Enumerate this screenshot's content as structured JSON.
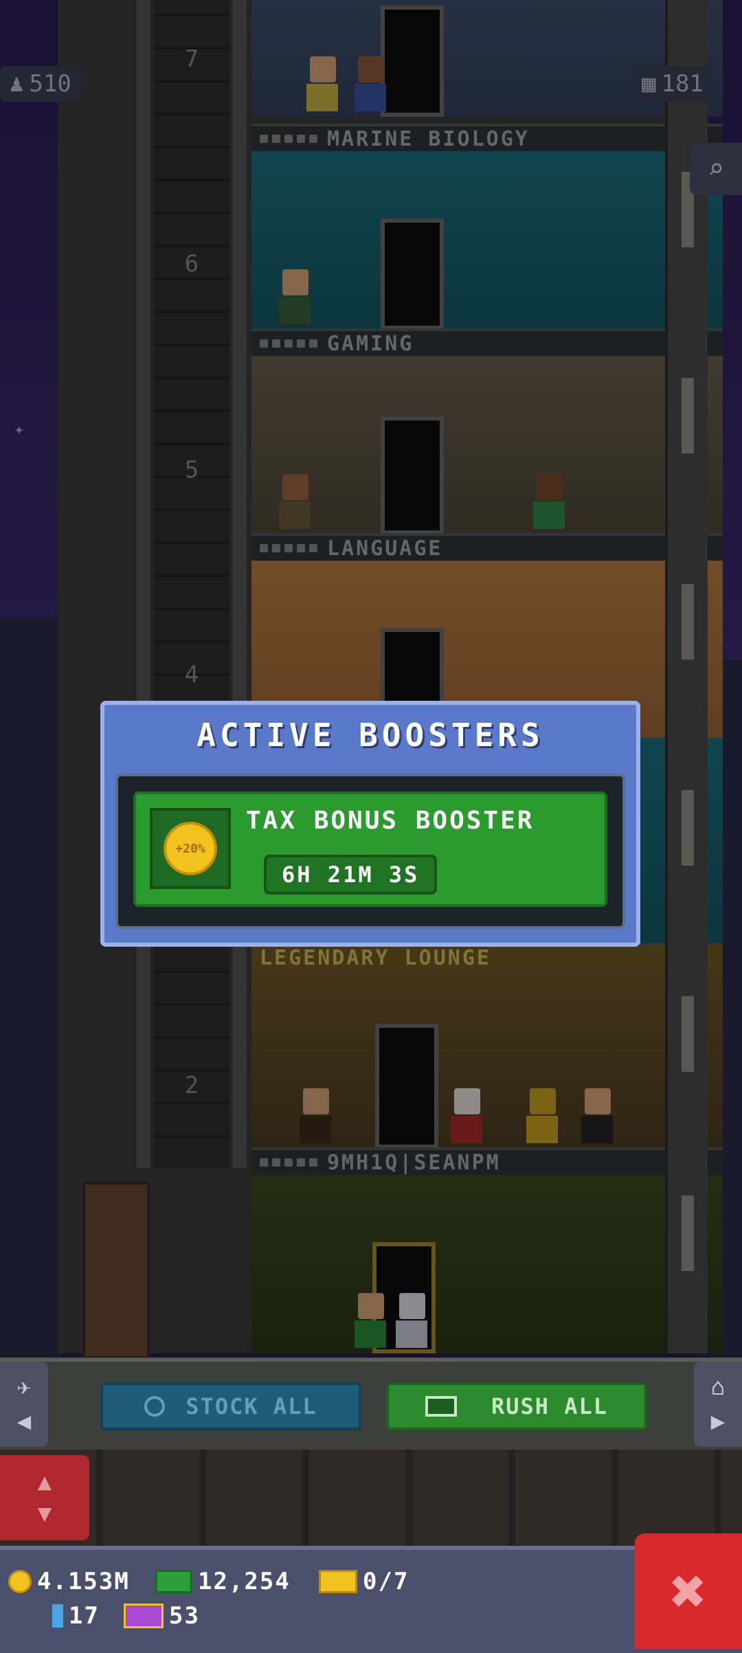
{
  "hud": {
    "population": "510",
    "floors_count": "181"
  },
  "floors": [
    {
      "number": "7",
      "name": ""
    },
    {
      "number": "6",
      "name": "MARINE BIOLOGY"
    },
    {
      "number": "5",
      "name": "GAMING"
    },
    {
      "number": "4",
      "name": "LANGUAGE"
    },
    {
      "number": "2",
      "name": "LEGENDARY LOUNGE"
    },
    {
      "number": "",
      "name": "9MH1Q|SEANPM"
    }
  ],
  "dialog": {
    "title": "ACTIVE BOOSTERS",
    "booster": {
      "name": "TAX BONUS BOOSTER",
      "timer": "6H 21M 3S",
      "badge": "+20%"
    }
  },
  "actions": {
    "stock_all": "STOCK ALL",
    "rush_all": "RUSH ALL"
  },
  "status": {
    "coins": "4.153M",
    "bux": "12,254",
    "vip": "0/7",
    "gems": "17",
    "tickets": "53"
  },
  "colors": {
    "dialog_bg": "#5a79c9",
    "booster_green": "#2b9a2f",
    "close_red": "#d8282d",
    "rush_green": "#2b8a2d",
    "stock_blue": "#1f5c78"
  },
  "icons": [
    "person-icon",
    "floors-icon",
    "search-icon",
    "clock-icon",
    "rush-icon",
    "coin-icon",
    "bux-icon",
    "vip-icon",
    "gem-icon",
    "ticket-icon",
    "close-icon",
    "elevator-up-down-icon",
    "plane-icon",
    "home-icon"
  ]
}
